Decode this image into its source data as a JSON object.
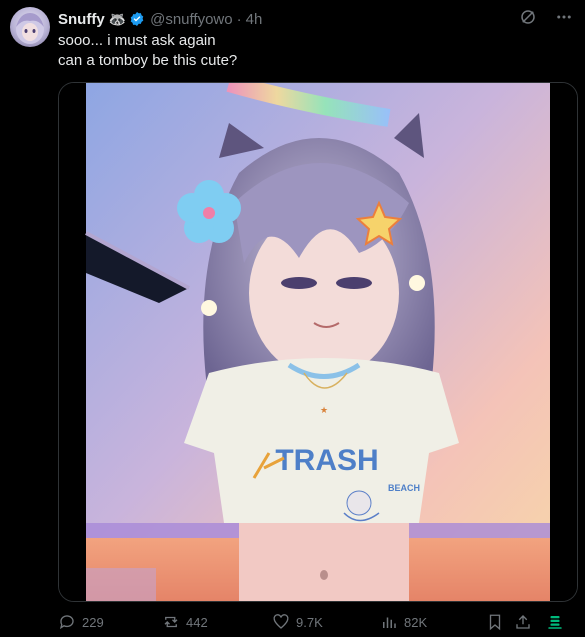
{
  "post": {
    "author": {
      "display_name": "Snuffy",
      "emoji": "🦝",
      "handle": "@snuffyowo",
      "separator": "·",
      "time": "4h"
    },
    "text_lines": [
      "sooo... i must ask again",
      "can a tomboy be this cute?"
    ],
    "media": {
      "image_text": "TRASH",
      "image_subtext": "BEACH"
    }
  },
  "actions": {
    "replies": "229",
    "reposts": "442",
    "likes": "9.7K",
    "views": "82K"
  },
  "icons": [
    "verified-icon",
    "grok-icon",
    "more-icon",
    "reply-icon",
    "repost-icon",
    "like-icon",
    "views-icon",
    "bookmark-icon",
    "share-icon",
    "analytics-icon"
  ],
  "colors": {
    "background": "#000000",
    "text": "#e7e9ea",
    "muted": "#71767b",
    "verified": "#1d9bf0",
    "analytics": "#00ba7c"
  }
}
